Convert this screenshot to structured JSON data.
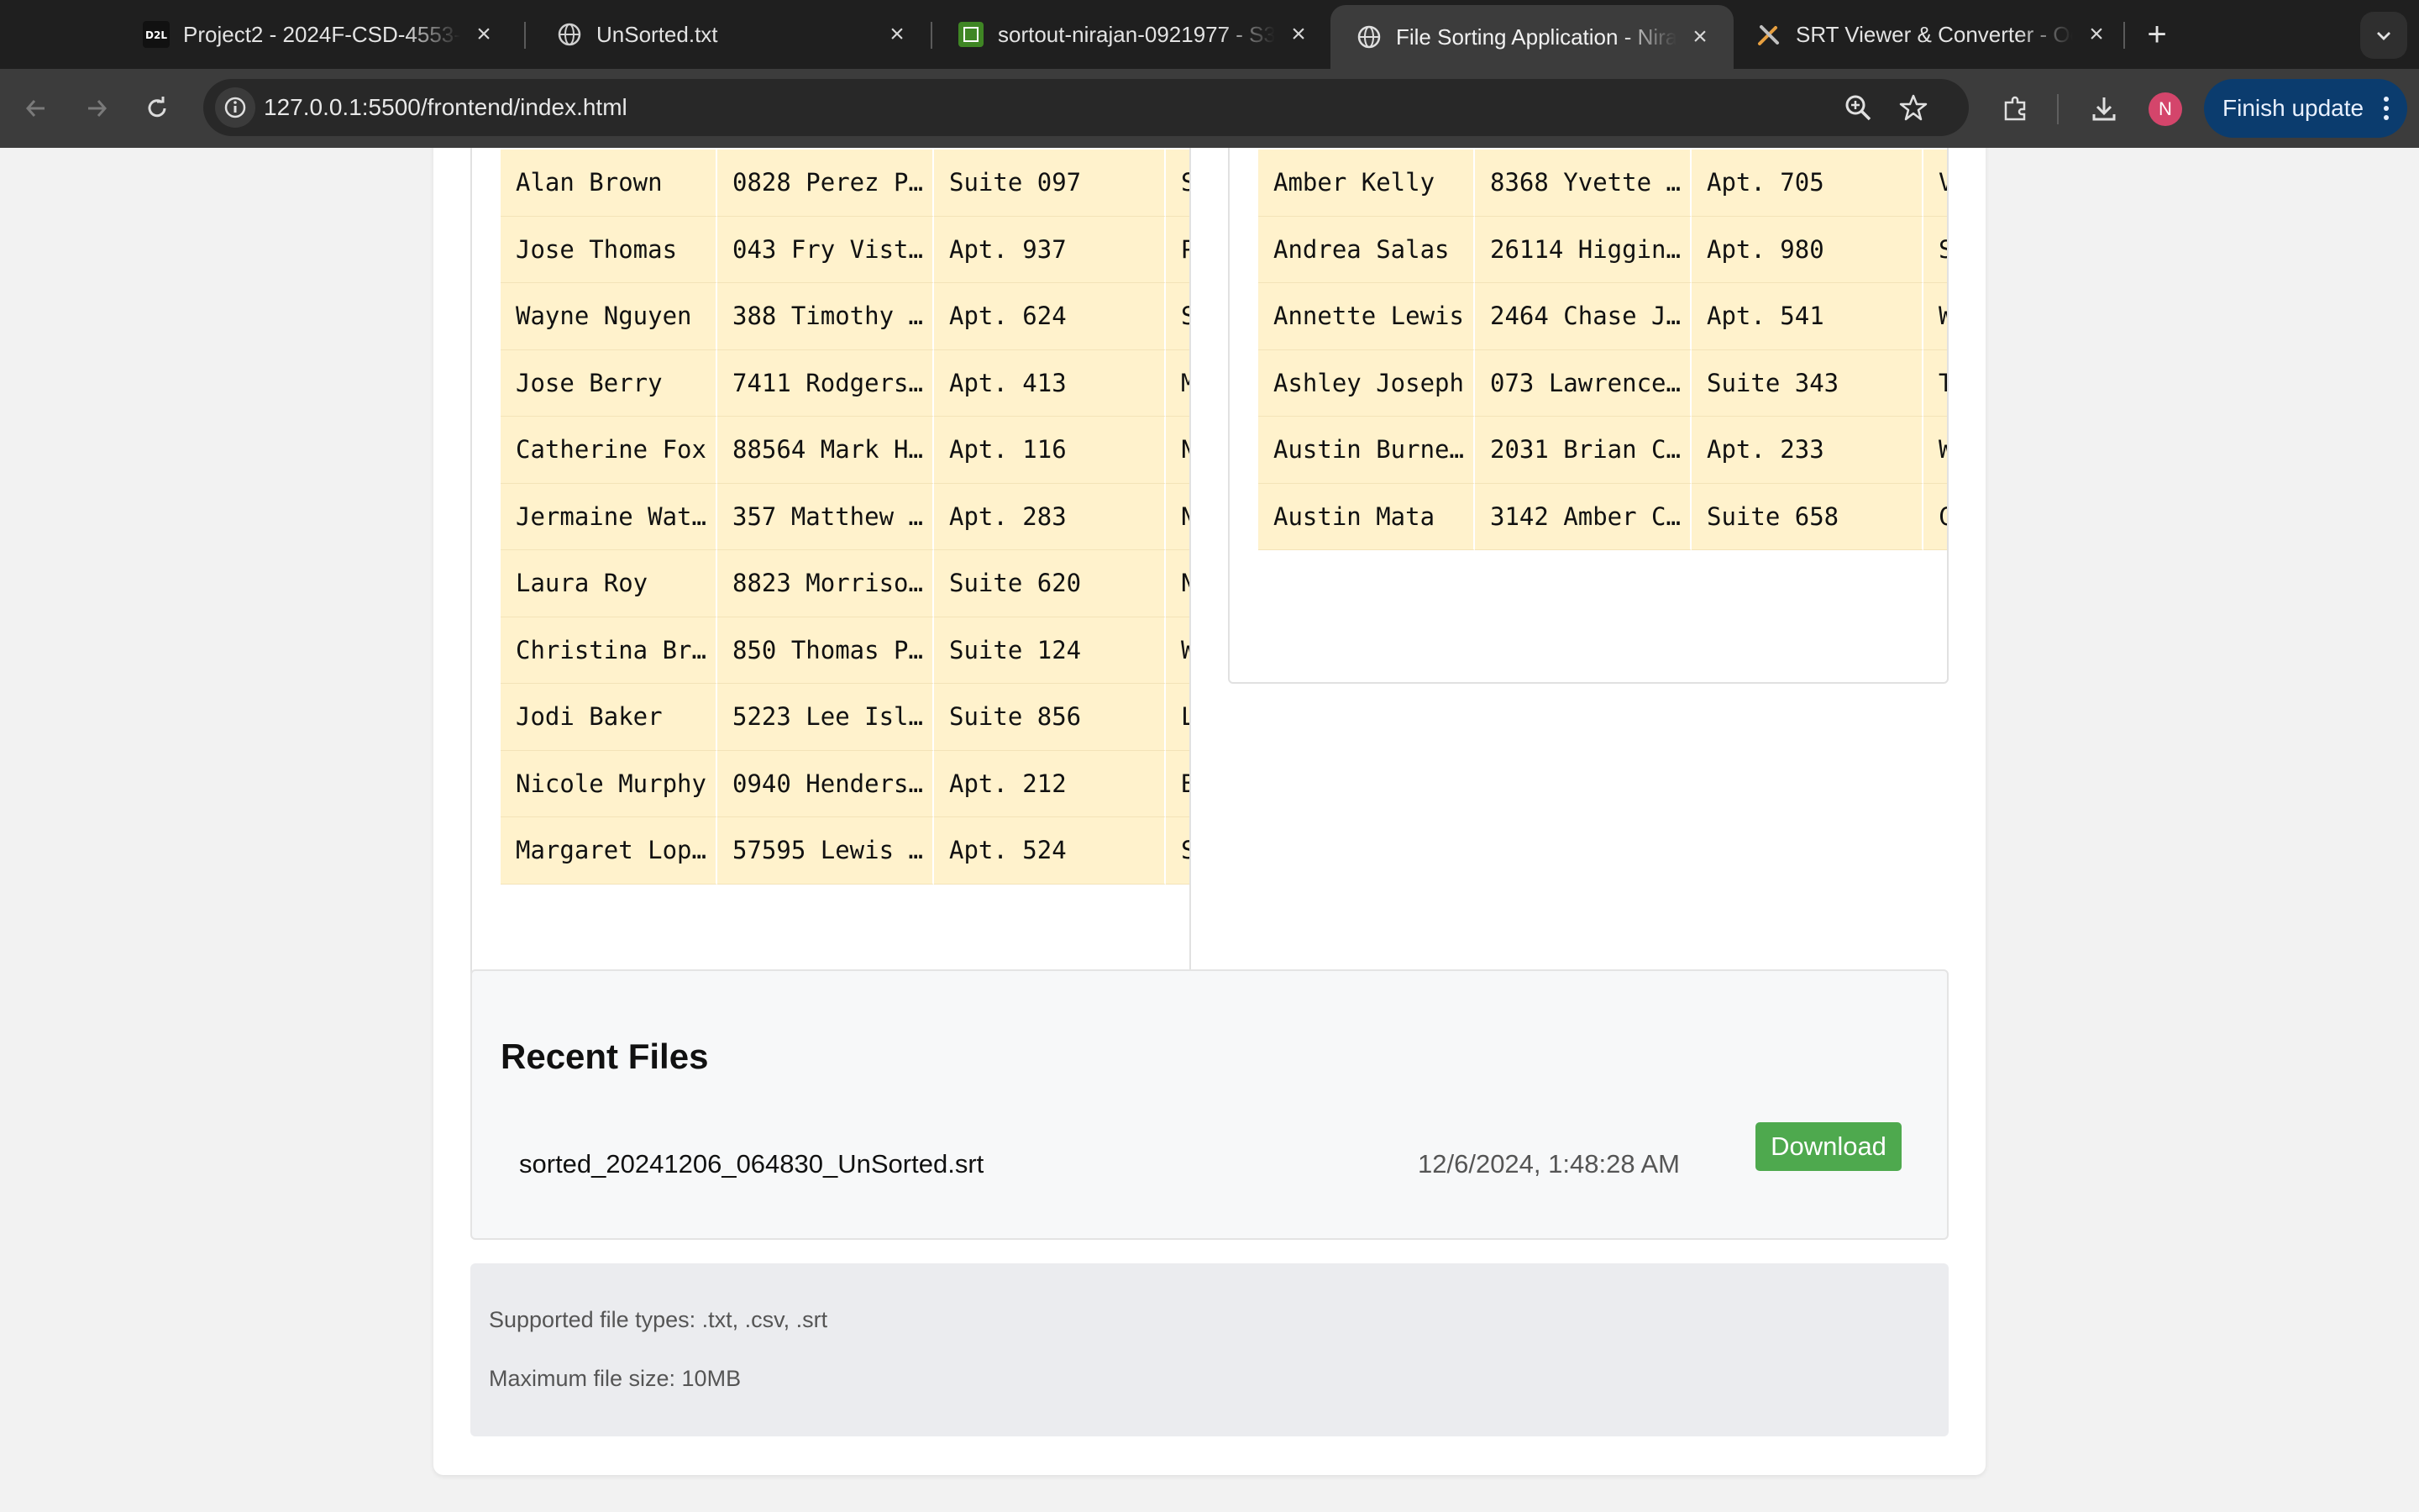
{
  "browser": {
    "tabs": [
      {
        "title": "Project2 - 2024F-CSD-4553-",
        "favicon": "d2l-icon"
      },
      {
        "title": "UnSorted.txt",
        "favicon": "globe-icon"
      },
      {
        "title": "sortout-nirajan-0921977 - S3",
        "favicon": "s3-icon"
      },
      {
        "title": "File Sorting Application - Nira",
        "favicon": "globe-icon",
        "active": true
      },
      {
        "title": "SRT Viewer & Converter - Oc",
        "favicon": "tools-icon"
      }
    ],
    "url": "127.0.0.1:5500/frontend/index.html",
    "avatar_letter": "N",
    "finish_update_label": "Finish update"
  },
  "tables": {
    "left_rows": [
      [
        "Alan Brown",
        "0828 Perez P…",
        "Suite 097",
        "So"
      ],
      [
        "Jose Thomas",
        "043 Fry Vist…",
        "Apt. 937",
        "Po"
      ],
      [
        "Wayne Nguyen",
        "388 Timothy …",
        "Apt. 624",
        "So"
      ],
      [
        "Jose Berry",
        "7411 Rodgers…",
        "Apt. 413",
        "Me"
      ],
      [
        "Catherine Fox",
        "88564 Mark H…",
        "Apt. 116",
        "No"
      ],
      [
        "Jermaine Wat…",
        "357 Matthew …",
        "Apt. 283",
        "No"
      ],
      [
        "Laura Roy",
        "8823 Morriso…",
        "Suite 620",
        "Ne"
      ],
      [
        "Christina Br…",
        "850 Thomas P…",
        "Suite 124",
        "We"
      ],
      [
        "Jodi Baker",
        "5223 Lee Isl…",
        "Suite 856",
        "Ly"
      ],
      [
        "Nicole Murphy",
        "0940 Henders…",
        "Apt. 212",
        "Br"
      ],
      [
        "Margaret Lop…",
        "57595 Lewis …",
        "Apt. 524",
        "Sm"
      ]
    ],
    "right_rows": [
      [
        "Amber Kelly",
        "8368 Yvette …",
        "Apt. 705",
        "Va"
      ],
      [
        "Andrea Salas",
        "26114 Higgin…",
        "Apt. 980",
        "So"
      ],
      [
        "Annette Lewis",
        "2464 Chase J…",
        "Apt. 541",
        "We"
      ],
      [
        "Ashley Joseph",
        "073 Lawrence…",
        "Suite 343",
        "Tr"
      ],
      [
        "Austin Burne…",
        "2031 Brian C…",
        "Apt. 233",
        "We"
      ],
      [
        "Austin Mata",
        "3142 Amber C…",
        "Suite 658",
        "Ca"
      ]
    ]
  },
  "recent": {
    "title": "Recent Files",
    "files": [
      {
        "name": "sorted_20241206_064830_UnSorted.srt",
        "date": "12/6/2024, 1:48:28 AM",
        "action": "Download"
      }
    ]
  },
  "info": {
    "supported": "Supported file types: .txt, .csv, .srt",
    "max_size": "Maximum file size: 10MB"
  },
  "colors": {
    "cell_bg": "#fff2cc",
    "download_button": "#4ea94e",
    "finish_update_bg": "#0b3c6e",
    "avatar": "#d4456b"
  }
}
